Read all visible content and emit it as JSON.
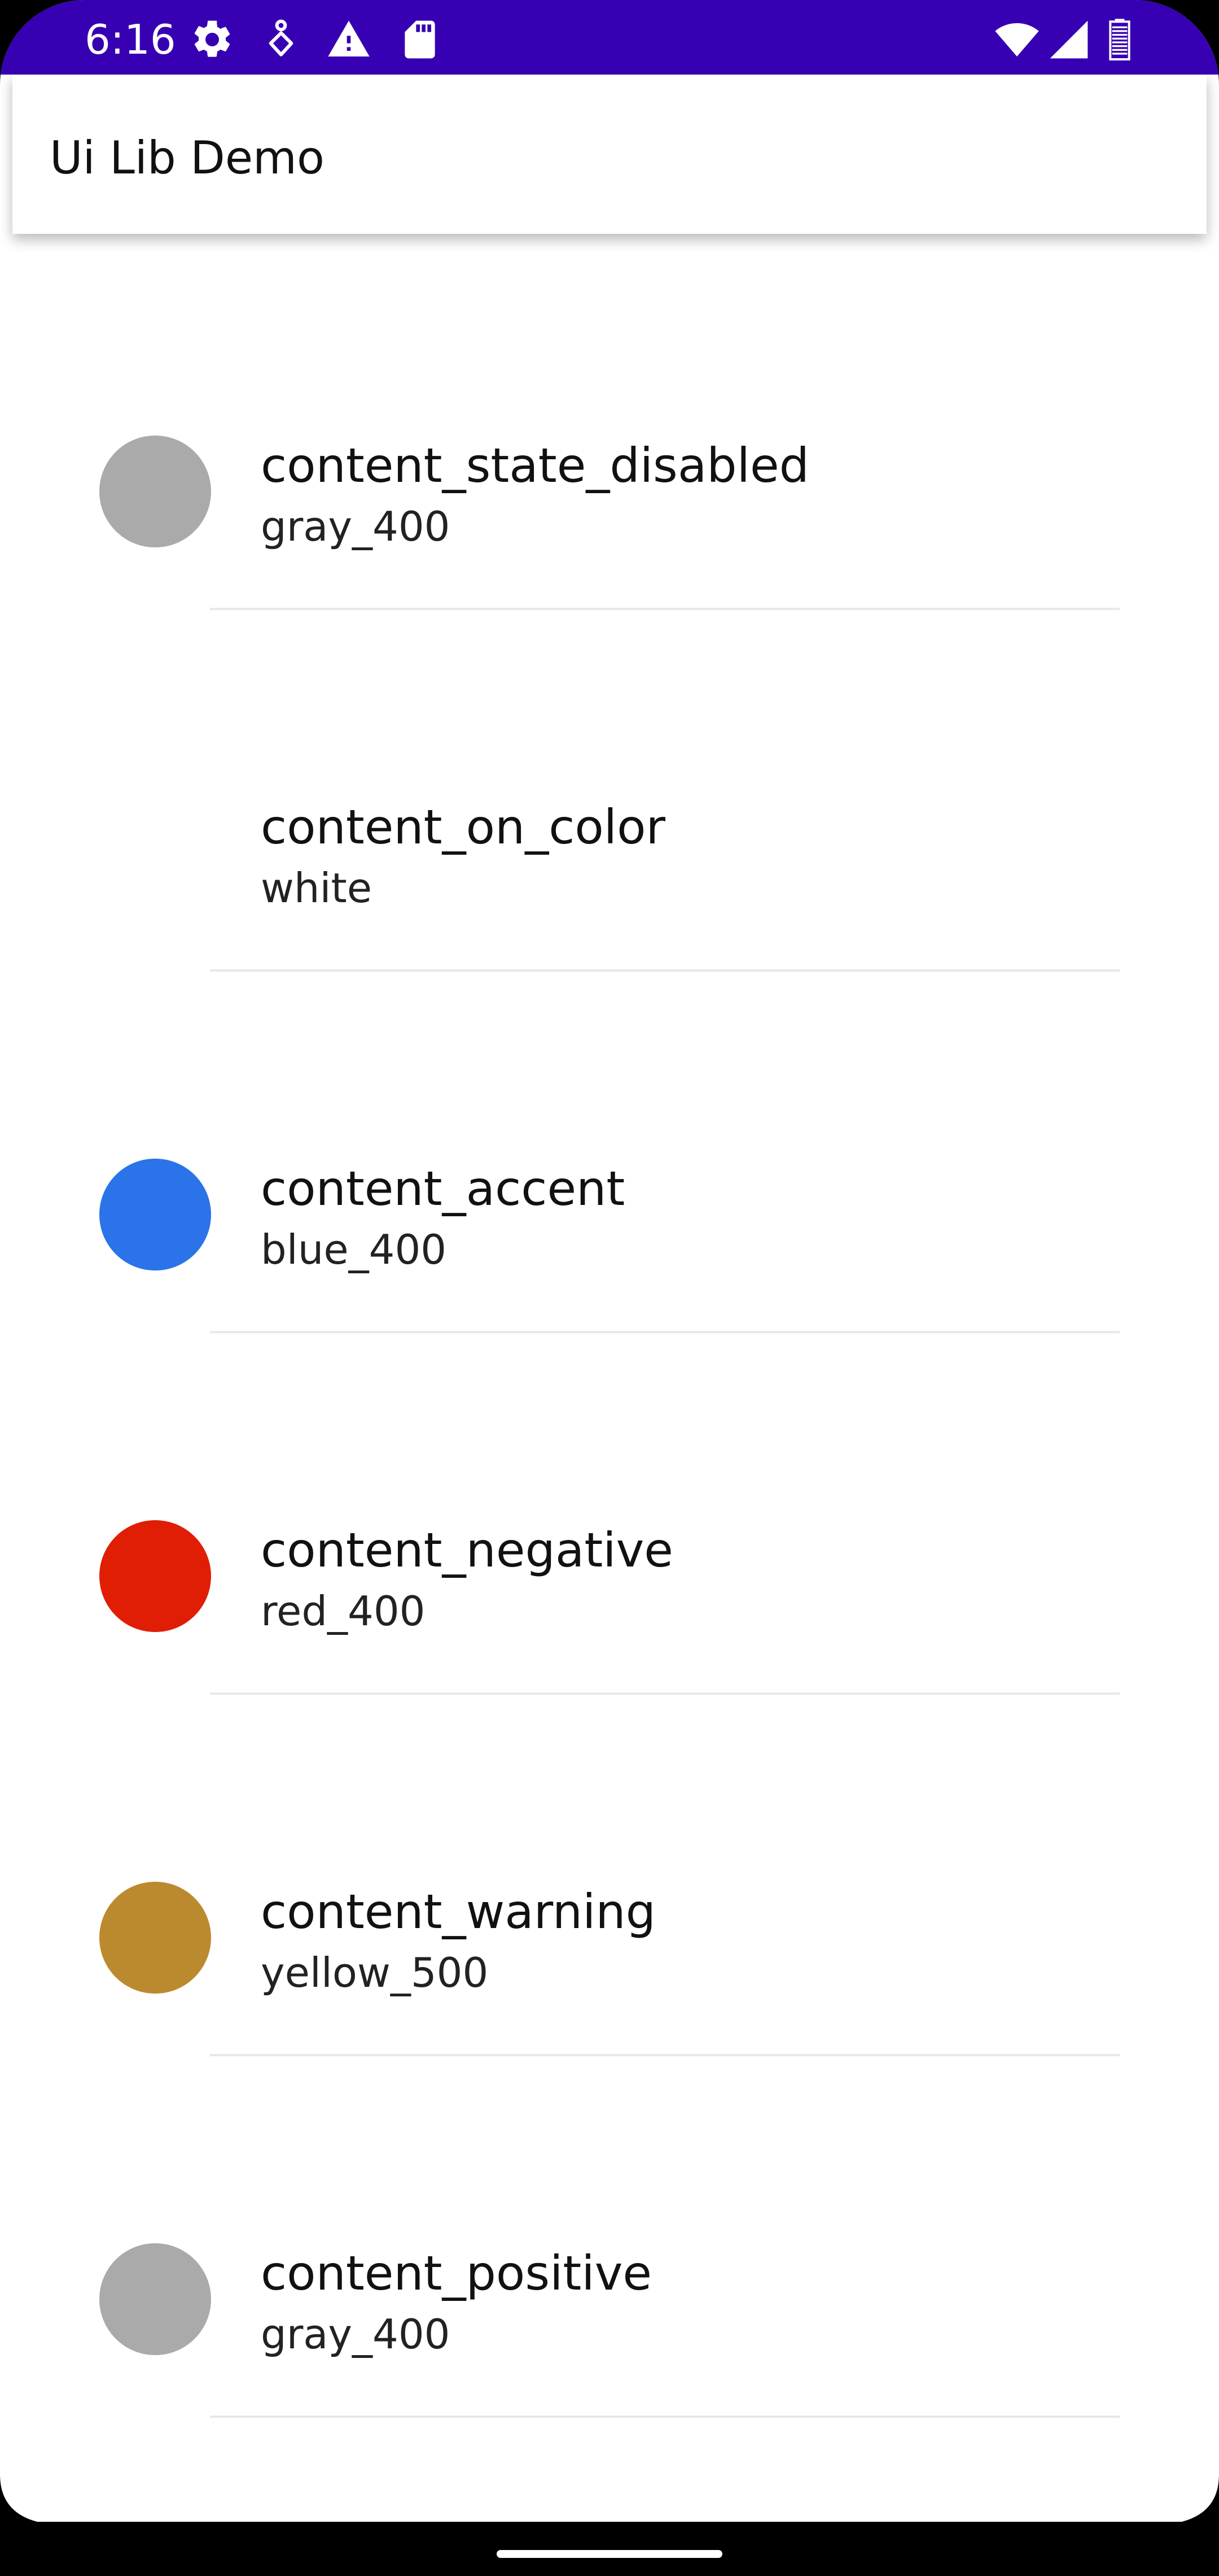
{
  "status_bar": {
    "time": "6:16",
    "background": "#3700b3",
    "left_icons": [
      "settings-icon",
      "accessibility-icon",
      "warning-icon",
      "sd-card-icon"
    ],
    "right_icons": [
      "wifi-icon",
      "signal-icon",
      "battery-icon"
    ]
  },
  "app_bar": {
    "title": "Ui Lib Demo"
  },
  "color_list": [
    {
      "name": "content_state_disabled",
      "value": "gray_400",
      "swatch": "#aaaaaa"
    },
    {
      "name": "content_on_color",
      "value": "white",
      "swatch": "#ffffff"
    },
    {
      "name": "content_accent",
      "value": "blue_400",
      "swatch": "#2a73e8"
    },
    {
      "name": "content_negative",
      "value": "red_400",
      "swatch": "#e01e05"
    },
    {
      "name": "content_warning",
      "value": "yellow_500",
      "swatch": "#bc8a2e"
    },
    {
      "name": "content_positive",
      "value": "gray_400",
      "swatch": "#aaaaaa"
    }
  ]
}
